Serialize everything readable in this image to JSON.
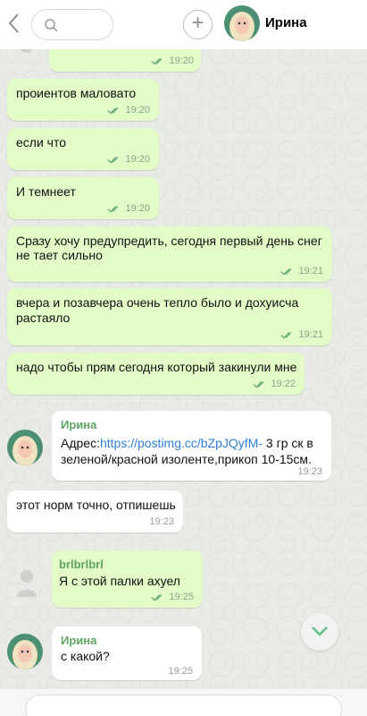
{
  "header": {
    "contact_name": "Ирина",
    "back_icon": "chevron-left-icon",
    "search_icon": "search-icon",
    "add_icon": "plus-icon"
  },
  "messages": [
    {
      "text": "",
      "time": "19:20"
    },
    {
      "text": "проиентов маловато",
      "time": "19:20"
    },
    {
      "text": "если что",
      "time": "19:20"
    },
    {
      "text": "И темнеет",
      "time": "19:20"
    },
    {
      "line1": "Сразу хочу предупредить, сегодня первый день снег",
      "line2": "не тает сильно",
      "time": "19:21"
    },
    {
      "line1": "вчера и позавчера очень тепло было и дохуисча",
      "line2": "растаяло",
      "time": "19:21"
    },
    {
      "text": "надо чтобы прям сегодня который закинули мне",
      "time": "19:22"
    },
    {
      "sender": "Ирина",
      "prefix": "Адрес:",
      "link": "https://postimg.cc/bZpJQyfM-",
      "rest1": " 3 гр ск  в",
      "line2": "зеленой/красной изоленте,прикоп 10-15см.",
      "time": "19:23"
    },
    {
      "text": "этот норм точно, отпишешь",
      "time": "19:23"
    },
    {
      "sender": "brlbrlbrl",
      "text": "Я с этой палки ахуел",
      "time": "19:25"
    },
    {
      "sender": "Ирина",
      "text": "с какой?",
      "time": "19:25"
    }
  ],
  "colors": {
    "outgoing_bubble": "#e3fbc7",
    "incoming_bubble": "#ffffff",
    "sender_name": "#5fa564",
    "link": "#2f7fd9",
    "background": "#e9ebe7"
  },
  "scroll_down_icon": "chevron-down-icon"
}
